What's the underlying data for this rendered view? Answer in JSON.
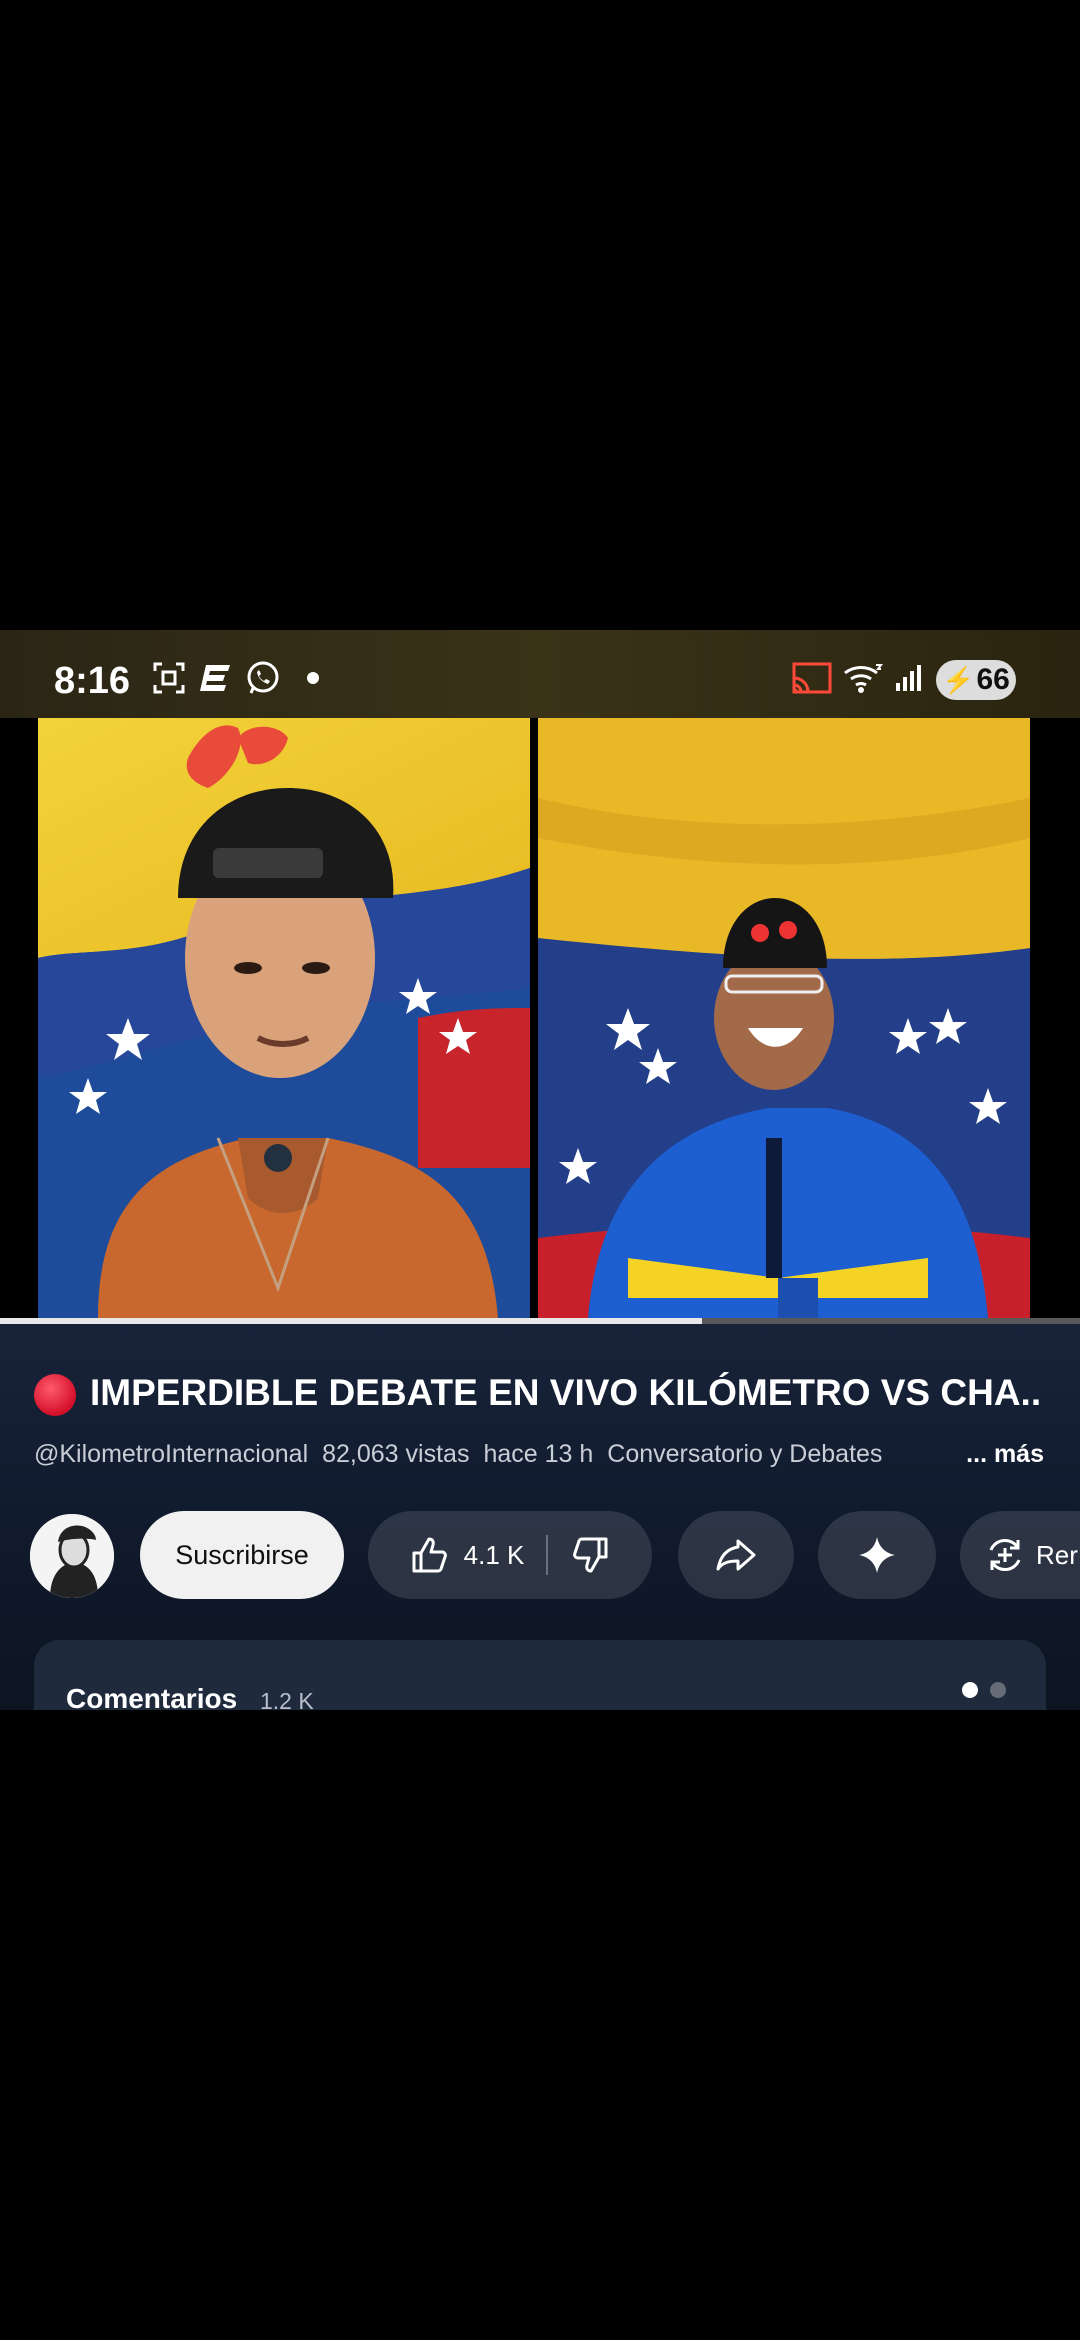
{
  "status_bar": {
    "time": "8:16",
    "battery": "66",
    "icons": [
      "screenshot-icon",
      "app-e-icon",
      "whatsapp-icon",
      "dot-icon",
      "cast-icon",
      "wifi-icon",
      "signal-icon",
      "battery-icon"
    ]
  },
  "video": {
    "progress_fraction": 0.65
  },
  "details": {
    "title": "IMPERDIBLE DEBATE EN VIVO KILÓMETRO VS CHA..",
    "channel": "@KilometroInternacional",
    "views": "82,063 vistas",
    "age": "hace 13 h",
    "category": "Conversatorio y Debates",
    "more": "... más"
  },
  "actions": {
    "subscribe": "Suscribirse",
    "likes": "4.1 K",
    "save_partial": "Rer"
  },
  "comments": {
    "label": "Comentarios",
    "count": "1.2 K"
  },
  "colors": {
    "live_red": "#e21b2e",
    "info_bg": "#14203a"
  }
}
